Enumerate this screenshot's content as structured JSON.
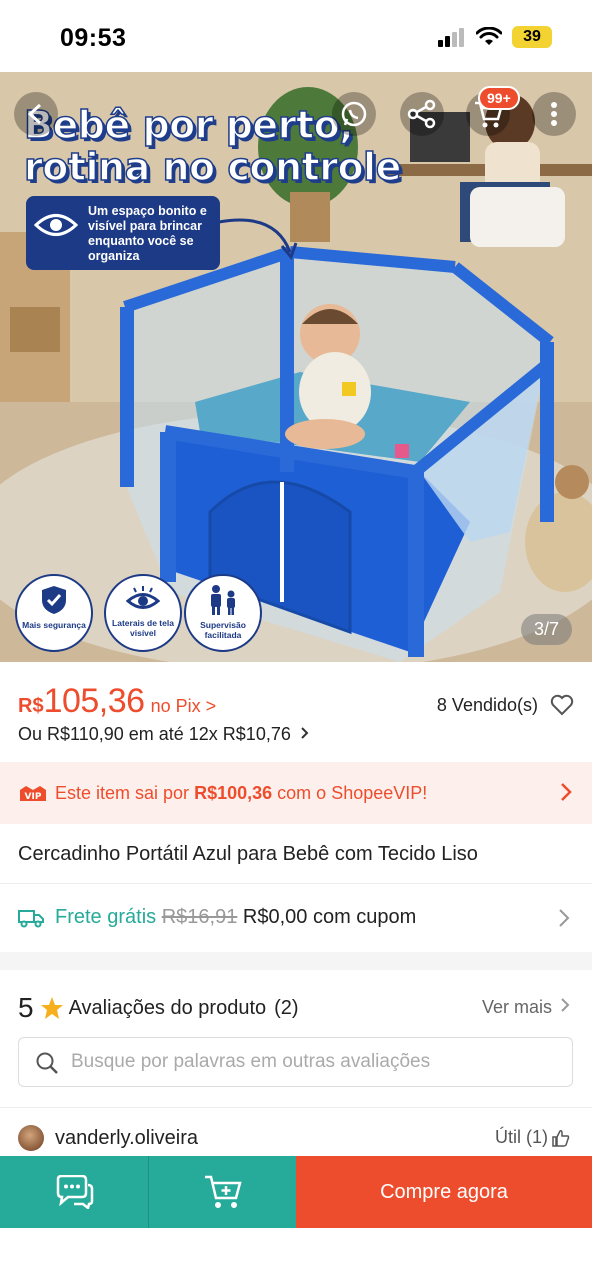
{
  "status_bar": {
    "time": "09:53",
    "battery": "39"
  },
  "hero": {
    "title_line1": "Bebê por perto,",
    "title_line2": "rotina no controle",
    "callout": "Um espaço bonito e visível para brincar enquanto você se organiza",
    "cart_badge": "99+",
    "features": [
      {
        "label": "Mais segurança",
        "icon": "shield-check-icon"
      },
      {
        "label": "Laterais de tela visível",
        "icon": "eye-icon"
      },
      {
        "label": "Supervisão facilitada",
        "icon": "people-icon"
      }
    ],
    "image_counter": "3/7",
    "top_icons": [
      "back-icon",
      "whatsapp-share-icon",
      "share-icon",
      "cart-icon",
      "more-icon"
    ]
  },
  "price": {
    "currency": "R$",
    "value": "105,36",
    "pix_label": "no Pix >",
    "installments": "Ou R$110,90 em até 12x R$10,76",
    "sold": "8 Vendido(s)"
  },
  "vip": {
    "logo": "VIP",
    "prefix": "Este item sai por",
    "price": "R$100,36",
    "suffix": "com o ShopeeVIP!"
  },
  "product": {
    "title": "Cercadinho Portátil Azul para Bebê com Tecido Liso"
  },
  "shipping": {
    "free_label": "Frete grátis",
    "old_price": "R$16,91",
    "new_price": "R$0,00 com cupom"
  },
  "reviews": {
    "score": "5",
    "title": "Avaliações do produto",
    "count": "(2)",
    "see_more": "Ver mais",
    "search_placeholder": "Busque por palavras em outras avaliações",
    "first_reviewer": "vanderly.oliveira",
    "useful_label": "Útil (1)"
  },
  "bottom_bar": {
    "buy_label": "Compre agora"
  },
  "colors": {
    "accent": "#ee4d2d",
    "teal": "#26aa99",
    "navy": "#1d3a86",
    "pen_blue": "#1f5fd6"
  }
}
